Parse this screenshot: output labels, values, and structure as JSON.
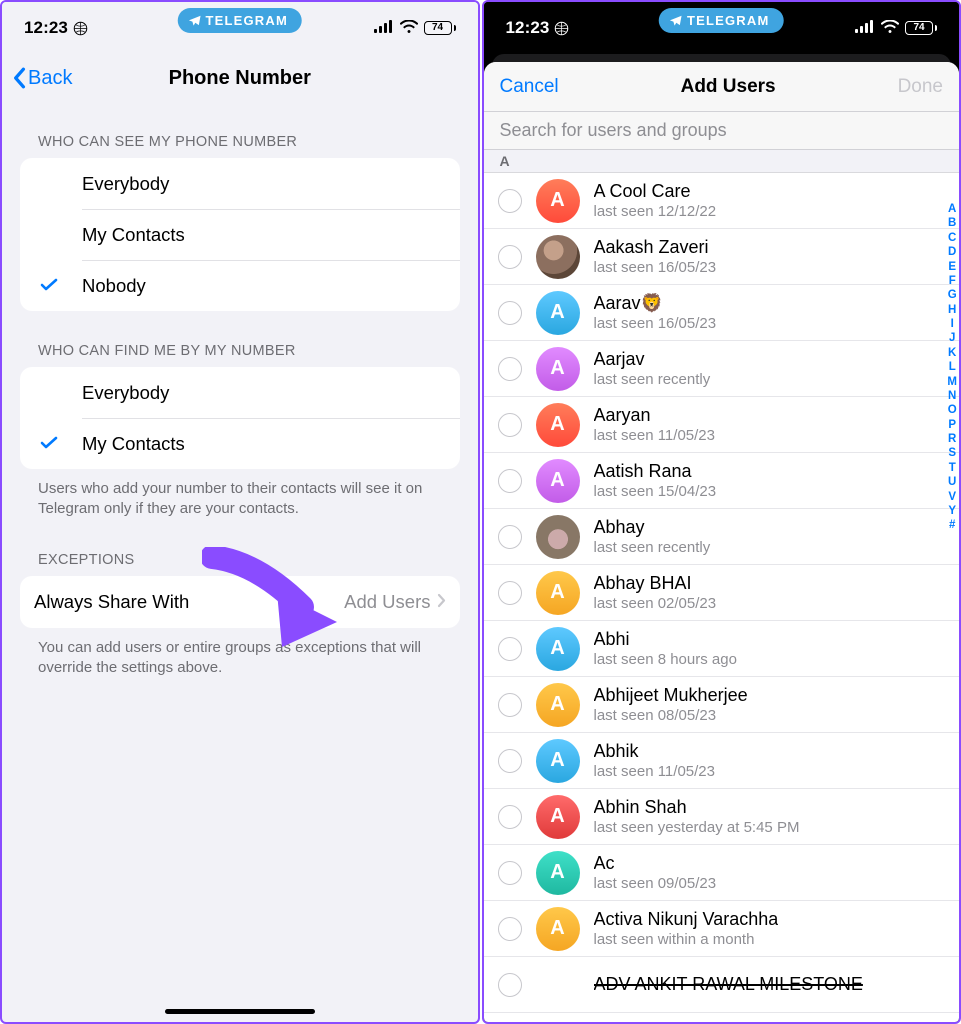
{
  "status": {
    "time": "12:23",
    "pill_label": "TELEGRAM",
    "battery_pct": "74"
  },
  "left": {
    "back_label": "Back",
    "title": "Phone Number",
    "section1_label": "WHO CAN SEE MY PHONE NUMBER",
    "opt_everybody": "Everybody",
    "opt_mycontacts": "My Contacts",
    "opt_nobody": "Nobody",
    "section2_label": "WHO CAN FIND ME BY MY NUMBER",
    "section2_footer": "Users who add your number to their contacts will see it on Telegram only if they are your contacts.",
    "section3_label": "EXCEPTIONS",
    "always_share_label": "Always Share With",
    "always_share_value": "Add Users",
    "section3_footer": "You can add users or entire groups as exceptions that will override the settings above."
  },
  "right": {
    "cancel_label": "Cancel",
    "title": "Add Users",
    "done_label": "Done",
    "search_placeholder": "Search for users and groups",
    "section_letter": "A",
    "contacts": [
      {
        "initial": "A",
        "color": "linear-gradient(180deg,#ff7d5a,#ff4a3a)",
        "name": "A Cool Care",
        "status": "last seen 12/12/22"
      },
      {
        "initial": "",
        "photo": "photo1",
        "name": "Aakash Zaveri",
        "status": "last seen 16/05/23"
      },
      {
        "initial": "A",
        "color": "linear-gradient(180deg,#5ec9ff,#2aa7e0)",
        "name": "Aarav🦁",
        "status": "last seen 16/05/23"
      },
      {
        "initial": "A",
        "color": "linear-gradient(180deg,#e18bff,#c25ce8)",
        "name": "Aarjav",
        "status": "last seen recently"
      },
      {
        "initial": "A",
        "color": "linear-gradient(180deg,#ff7d5a,#ff4a3a)",
        "name": "Aaryan",
        "status": "last seen 11/05/23"
      },
      {
        "initial": "A",
        "color": "linear-gradient(180deg,#e18bff,#c25ce8)",
        "name": "Aatish Rana",
        "status": "last seen 15/04/23"
      },
      {
        "initial": "",
        "photo": "photo2",
        "name": "Abhay",
        "status": "last seen recently"
      },
      {
        "initial": "A",
        "color": "linear-gradient(180deg,#ffc84a,#f5a623)",
        "name": "Abhay BHAI",
        "status": "last seen 02/05/23"
      },
      {
        "initial": "A",
        "color": "linear-gradient(180deg,#5ec9ff,#2aa7e0)",
        "name": "Abhi",
        "status": "last seen 8 hours ago"
      },
      {
        "initial": "A",
        "color": "linear-gradient(180deg,#ffc84a,#f5a623)",
        "name": "Abhijeet Mukherjee",
        "status": "last seen 08/05/23"
      },
      {
        "initial": "A",
        "color": "linear-gradient(180deg,#5ec9ff,#2aa7e0)",
        "name": "Abhik",
        "status": "last seen 11/05/23"
      },
      {
        "initial": "A",
        "color": "linear-gradient(180deg,#ff6b6b,#e03a3a)",
        "name": "Abhin Shah",
        "status": "last seen yesterday at 5:45 PM"
      },
      {
        "initial": "A",
        "color": "linear-gradient(180deg,#3fe0c8,#1fb8a0)",
        "name": "Ac",
        "status": "last seen 09/05/23"
      },
      {
        "initial": "A",
        "color": "linear-gradient(180deg,#ffc84a,#f5a623)",
        "name": "Activa Nikunj Varachha",
        "status": "last seen within a month"
      },
      {
        "initial": "",
        "name_strike": "ADV ANKIT RAWAL MILESTONE",
        "status": ""
      }
    ],
    "index_letters": [
      "A",
      "B",
      "C",
      "D",
      "E",
      "F",
      "G",
      "H",
      "I",
      "J",
      "K",
      "L",
      "M",
      "N",
      "O",
      "P",
      "R",
      "S",
      "T",
      "U",
      "V",
      "Y",
      "#"
    ]
  }
}
